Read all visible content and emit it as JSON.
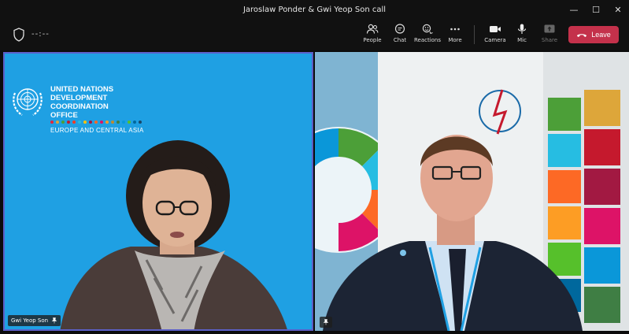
{
  "window": {
    "title": "Jaroslaw Ponder & Gwi Yeop Son call",
    "minimize": "—",
    "maximize": "☐",
    "close": "✕"
  },
  "toolbar": {
    "timer": "--:--",
    "buttons": [
      {
        "label": "People",
        "icon": "people-icon"
      },
      {
        "label": "Chat",
        "icon": "chat-icon"
      },
      {
        "label": "Reactions",
        "icon": "reactions-icon"
      },
      {
        "label": "More",
        "icon": "more-icon"
      },
      {
        "label": "Camera",
        "icon": "camera-icon"
      },
      {
        "label": "Mic",
        "icon": "mic-icon"
      },
      {
        "label": "Share",
        "icon": "share-icon"
      }
    ],
    "leave_label": "Leave",
    "leave_color": "#c4314b"
  },
  "participants": [
    {
      "name": "Gwi Yeop Son",
      "background_text": {
        "org_lines": [
          "UNITED NATIONS",
          "DEVELOPMENT",
          "COORDINATION",
          "OFFICE"
        ],
        "region": "EUROPE AND CENTRAL ASIA"
      },
      "pinned": true,
      "active_speaker": true
    },
    {
      "name": "",
      "pinned": true
    }
  ],
  "colors": {
    "left_tile_bg": "#1fa0e3",
    "active_border": "#5b5fc7",
    "titlebar_bg": "#111111"
  }
}
